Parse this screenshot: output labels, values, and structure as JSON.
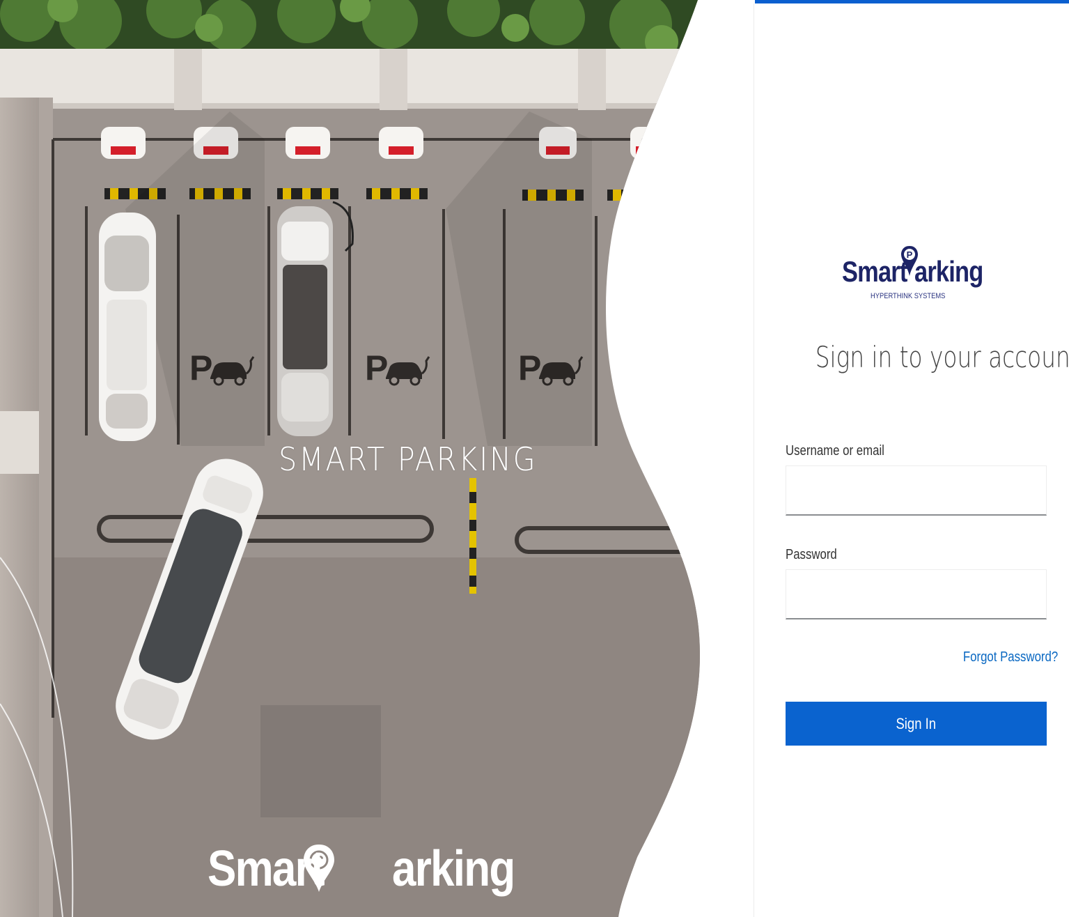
{
  "hero": {
    "title": "SMART PARKING",
    "logo_left": "Smart",
    "logo_right": "arking",
    "pin_letter": "P",
    "stall_marks": [
      "P",
      "P",
      "P"
    ]
  },
  "brand": {
    "name_left": "Smart",
    "name_right": "arking",
    "pin_letter": "P",
    "tagline": "HYPERTHINK SYSTEMS"
  },
  "login": {
    "title": "Sign in to your account",
    "username_label": "Username or email",
    "username_value": "",
    "password_label": "Password",
    "password_value": "",
    "forgot_label": "Forgot Password?",
    "submit_label": "Sign In"
  },
  "colors": {
    "accent": "#0a63cf",
    "brand": "#1d2466",
    "link": "#0a68c2"
  }
}
